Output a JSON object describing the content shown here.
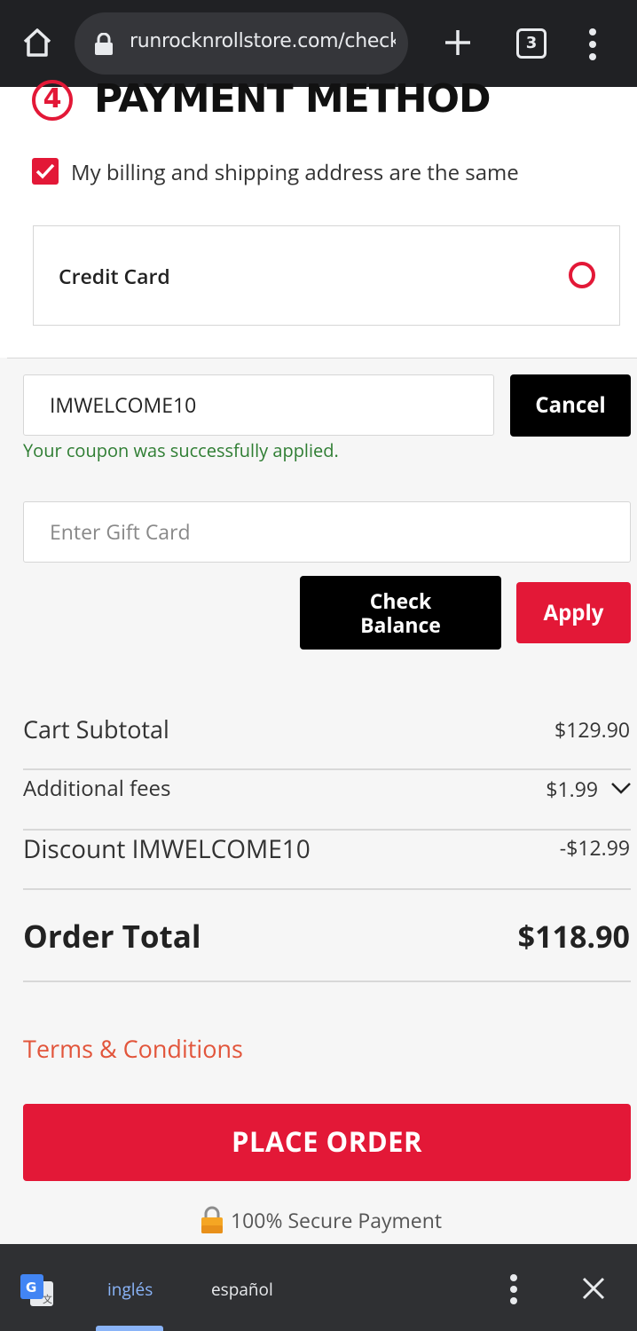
{
  "browser": {
    "url": "runrocknrollstore.com/checko",
    "tab_count": "3"
  },
  "payment": {
    "step_number": "4",
    "title": "PAYMENT METHOD",
    "same_address_label": "My billing and shipping address are the same",
    "same_address_checked": true,
    "credit_card_label": "Credit Card"
  },
  "coupon": {
    "value": "IMWELCOME10",
    "cancel_label": "Cancel",
    "success_message": "Your coupon was successfully applied."
  },
  "gift_card": {
    "placeholder": "Enter Gift Card",
    "check_balance_label_line1": "Check",
    "check_balance_label_line2": "Balance",
    "apply_label": "Apply"
  },
  "totals": {
    "subtotal_label": "Cart Subtotal",
    "subtotal_value": "$129.90",
    "fees_label": "Additional fees",
    "fees_value": "$1.99",
    "discount_label": "Discount IMWELCOME10",
    "discount_value": "-$12.99",
    "order_total_label": "Order Total",
    "order_total_value": "$118.90"
  },
  "terms_label": "Terms & Conditions",
  "place_order_label": "PLACE ORDER",
  "secure_label": "100% Secure Payment",
  "translate_bar": {
    "source_lang": "inglés",
    "target_lang": "español"
  },
  "colors": {
    "brand_red": "#e31837",
    "success_green": "#2e7d32",
    "terms_orange": "#e2553b"
  }
}
